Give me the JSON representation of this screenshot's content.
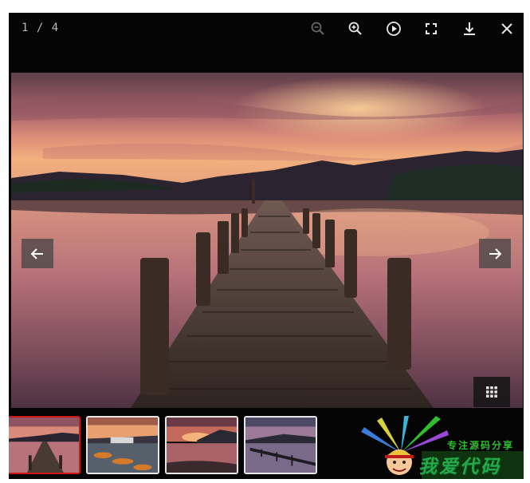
{
  "toolbar": {
    "counter": "1 / 4",
    "buttons": [
      {
        "name": "zoom-out-icon"
      },
      {
        "name": "zoom-in-icon"
      },
      {
        "name": "play-icon"
      },
      {
        "name": "fullscreen-icon"
      },
      {
        "name": "download-icon"
      },
      {
        "name": "close-icon"
      }
    ]
  },
  "viewer": {
    "prev_icon": "arrow-left-icon",
    "next_icon": "arrow-right-icon",
    "grid_icon": "grid-icon"
  },
  "thumbnails": [
    {
      "subject": "pier at sunset",
      "active": true
    },
    {
      "subject": "boats on lake",
      "active": false
    },
    {
      "subject": "lake at dusk",
      "active": false
    },
    {
      "subject": "long jetty",
      "active": false
    }
  ],
  "watermark": {
    "tagline": "专注源码分享",
    "title": "我爱代码"
  },
  "colors": {
    "viewer_bg": "#050505",
    "active_thumb_border": "#d01616",
    "watermark_green": "#24a84a"
  }
}
